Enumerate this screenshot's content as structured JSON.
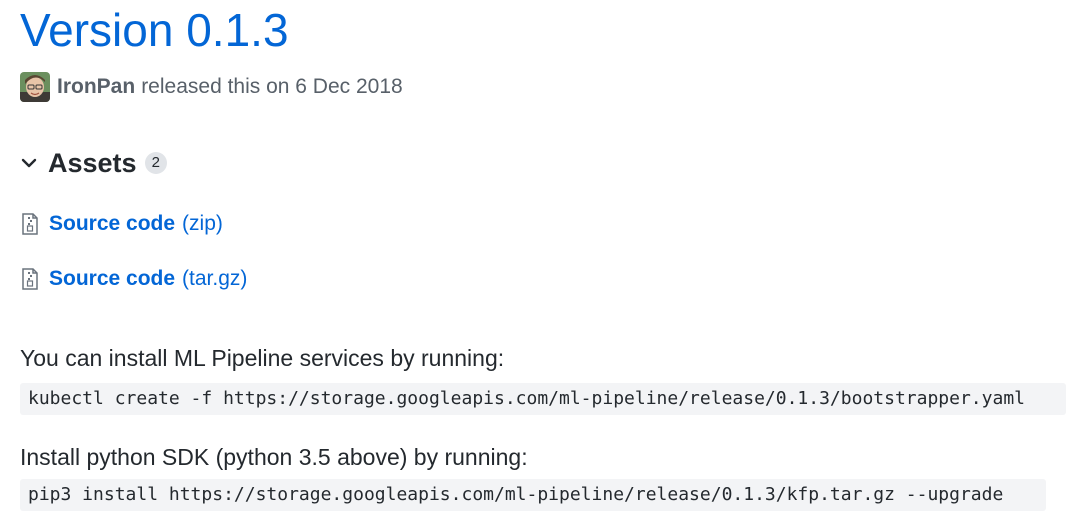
{
  "release": {
    "title": "Version 0.1.3",
    "author": "IronPan",
    "meta_text": "released this on 6 Dec 2018",
    "avatar_icon": "user-avatar"
  },
  "assets": {
    "title": "Assets",
    "count": "2",
    "expanded_icon": "chevron-down-icon",
    "items": [
      {
        "name": "Source code",
        "kind": "(zip)",
        "icon": "file-zip-icon"
      },
      {
        "name": "Source code",
        "kind": "(tar.gz)",
        "icon": "file-zip-icon"
      }
    ]
  },
  "notes": {
    "install_services_text": "You can install ML Pipeline services by running:",
    "install_services_cmd": "kubectl create -f https://storage.googleapis.com/ml-pipeline/release/0.1.3/bootstrapper.yaml",
    "install_sdk_text": "Install python SDK (python 3.5 above) by running:",
    "install_sdk_cmd": "pip3 install https://storage.googleapis.com/ml-pipeline/release/0.1.3/kfp.tar.gz --upgrade"
  },
  "colors": {
    "link": "#0366d6",
    "text": "#24292e",
    "muted": "#586069",
    "code_bg": "#f3f4f6"
  }
}
